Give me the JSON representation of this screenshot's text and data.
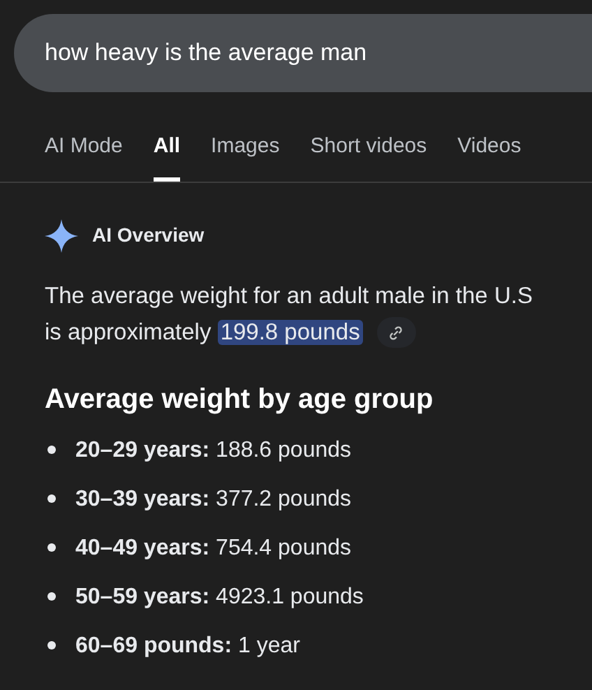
{
  "search": {
    "value": "how heavy is the average man"
  },
  "tabs": [
    {
      "label": "AI Mode",
      "selected": false
    },
    {
      "label": "All",
      "selected": true
    },
    {
      "label": "Images",
      "selected": false
    },
    {
      "label": "Short videos",
      "selected": false
    },
    {
      "label": "Videos",
      "selected": false
    }
  ],
  "overview": {
    "title": "AI Overview",
    "text": "The average weight for an adult male in the U.S is approximately",
    "highlight": "199.8 pounds"
  },
  "section": {
    "heading": "Average weight by age group",
    "items": [
      "**20–29 years:** 188.6 pounds",
      "**30–39 years:** 377.2 pounds",
      "**40–49 years:** 754.4 pounds",
      "**50–59 years:** 4923.1 pounds",
      "**60–69 pounds:** 1 year"
    ]
  }
}
